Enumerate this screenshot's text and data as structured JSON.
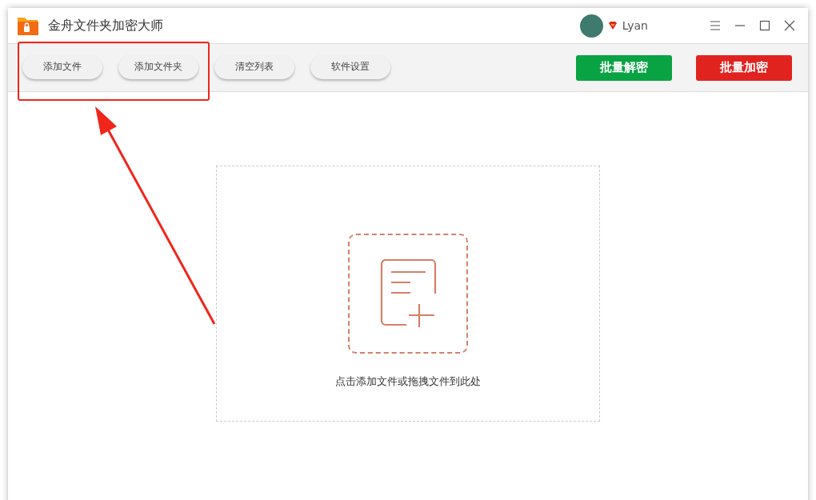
{
  "window": {
    "title": "金舟文件夹加密大师"
  },
  "user": {
    "name": "Lyan"
  },
  "toolbar": {
    "buttons": [
      {
        "label": "添加文件"
      },
      {
        "label": "添加文件夹"
      },
      {
        "label": "清空列表"
      },
      {
        "label": "软件设置"
      }
    ],
    "actions": [
      {
        "label": "批量解密",
        "kind": "decrypt"
      },
      {
        "label": "批量加密",
        "kind": "encrypt"
      }
    ]
  },
  "drop_zone": {
    "hint": "点击添加文件或拖拽文件到此处"
  }
}
